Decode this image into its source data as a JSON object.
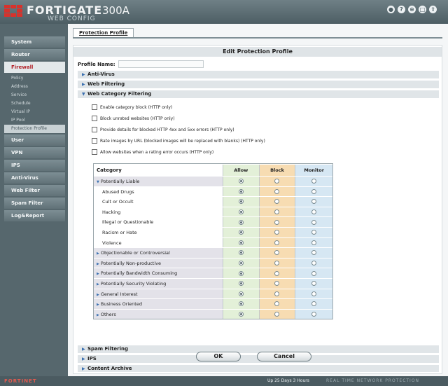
{
  "header": {
    "brand": "FORTIGATE",
    "model": "300A",
    "subtitle": "WEB CONFIG",
    "icons": [
      "wizard-icon",
      "help-icon",
      "console-icon",
      "refresh-icon",
      "logout-icon"
    ],
    "icon_glyphs": [
      "●",
      "?",
      "⊕",
      "□",
      "⇧"
    ]
  },
  "sidebar": {
    "items": [
      {
        "label": "System"
      },
      {
        "label": "Router"
      },
      {
        "label": "Firewall",
        "active": true
      },
      {
        "label": "User"
      },
      {
        "label": "VPN"
      },
      {
        "label": "IPS"
      },
      {
        "label": "Anti-Virus"
      },
      {
        "label": "Web Filter"
      },
      {
        "label": "Spam Filter"
      },
      {
        "label": "Log&Report"
      }
    ],
    "firewall_sub": [
      "Policy",
      "Address",
      "Service",
      "Schedule",
      "Virtual IP",
      "IP Pool",
      "Protection Profile"
    ]
  },
  "main": {
    "tab_label": "Protection Profile",
    "panel_title": "Edit Protection Profile",
    "profile_name_label": "Profile Name:",
    "profile_name_value": "",
    "sections": {
      "anti_virus": "Anti-Virus",
      "web_filtering": "Web Filtering",
      "web_category": "Web Category Filtering",
      "spam": "Spam Filtering",
      "ips": "IPS",
      "content_archive": "Content Archive"
    },
    "options": [
      "Enable category block (HTTP only)",
      "Block unrated websites (HTTP only)",
      "Provide details for blocked HTTP 4xx and 5xx errors (HTTP only)",
      "Rate images by URL (blocked images will be replaced with blanks) (HTTP only)",
      "Allow websites when a rating error occurs (HTTP only)"
    ],
    "table": {
      "headers": [
        "Category",
        "Allow",
        "Block",
        "Monitor"
      ],
      "rows": [
        {
          "name": "Potentially Liable",
          "group": true,
          "expanded": true
        },
        {
          "name": "Abused Drugs"
        },
        {
          "name": "Cult or Occult"
        },
        {
          "name": "Hacking"
        },
        {
          "name": "Illegal or Questionable"
        },
        {
          "name": "Racism or Hate"
        },
        {
          "name": "Violence"
        },
        {
          "name": "Objectionable or Controversial",
          "group": true
        },
        {
          "name": "Potentially Non-productive",
          "group": true
        },
        {
          "name": "Potentially Bandwidth Consuming",
          "group": true
        },
        {
          "name": "Potentially Security Violating",
          "group": true
        },
        {
          "name": "General Interest",
          "group": true
        },
        {
          "name": "Business Oriented",
          "group": true
        },
        {
          "name": "Others",
          "group": true
        }
      ],
      "selected": "Allow"
    },
    "buttons": {
      "ok": "OK",
      "cancel": "Cancel"
    }
  },
  "footer": {
    "brand": "FORTINET",
    "uptime": "Up 25 Days 3 Hours",
    "tagline": "REAL TIME NETWORK PROTECTION"
  },
  "colors": {
    "header": "#56676d",
    "accent_red": "#d8322c",
    "allow_col": "#e3f0d8",
    "block_col": "#f7dcb2",
    "monitor_col": "#d6e7f3"
  }
}
